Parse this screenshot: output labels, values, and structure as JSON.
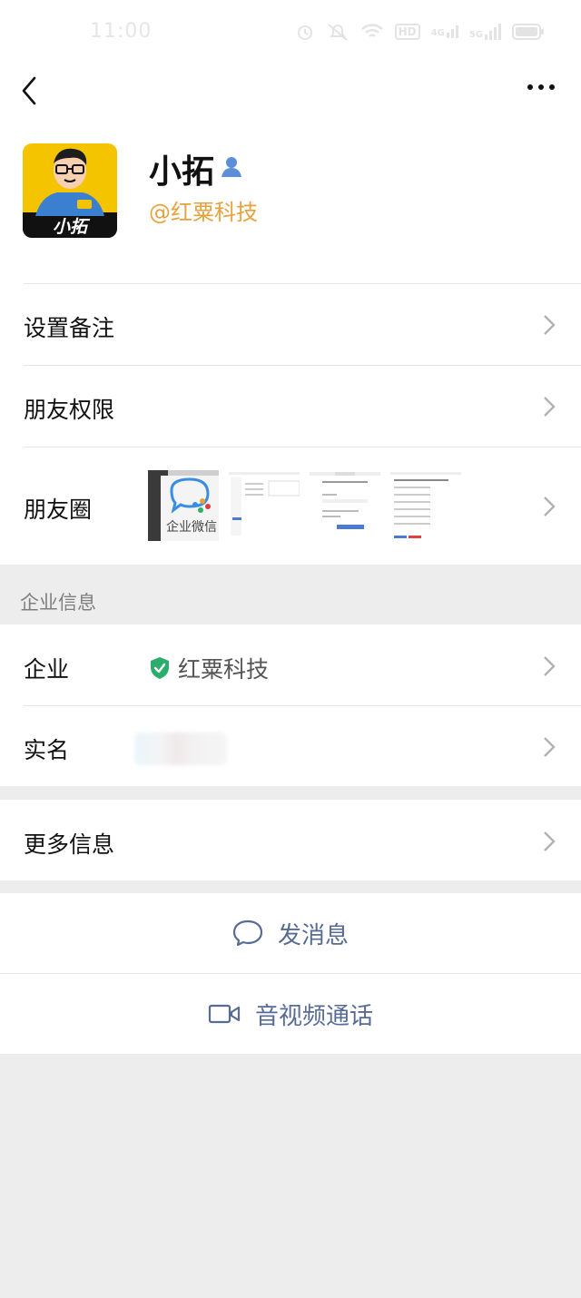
{
  "status_bar": {
    "time": "11:00",
    "icons": [
      "alarm-icon",
      "mute-icon",
      "wifi-icon",
      "hd-icon",
      "signal-4g-icon",
      "signal-5g-icon",
      "battery-icon"
    ],
    "hd_label": "HD",
    "net_4g_label": "4G",
    "net_5g_label": "5G"
  },
  "nav": {
    "back_icon": "back-arrow-icon",
    "more_icon": "more-icon"
  },
  "profile": {
    "name": "小拓",
    "org_handle": "@红粟科技",
    "avatar_caption": "小拓",
    "avatar_bg": "#f5c400"
  },
  "rows": {
    "remark": "设置备注",
    "permissions": "朋友权限",
    "moments": "朋友圈",
    "moments_thumb_caption": "企业微信"
  },
  "enterprise_section": {
    "header": "企业信息",
    "company_label": "企业",
    "company_value": "红粟科技",
    "realname_label": "实名"
  },
  "more_info": "更多信息",
  "actions": {
    "message": "发消息",
    "call": "音视频通话",
    "link_color": "#576b95"
  },
  "colors": {
    "accent_orange": "#e6a23c",
    "verified_green": "#2bad6b",
    "page_bg": "#ededed"
  }
}
